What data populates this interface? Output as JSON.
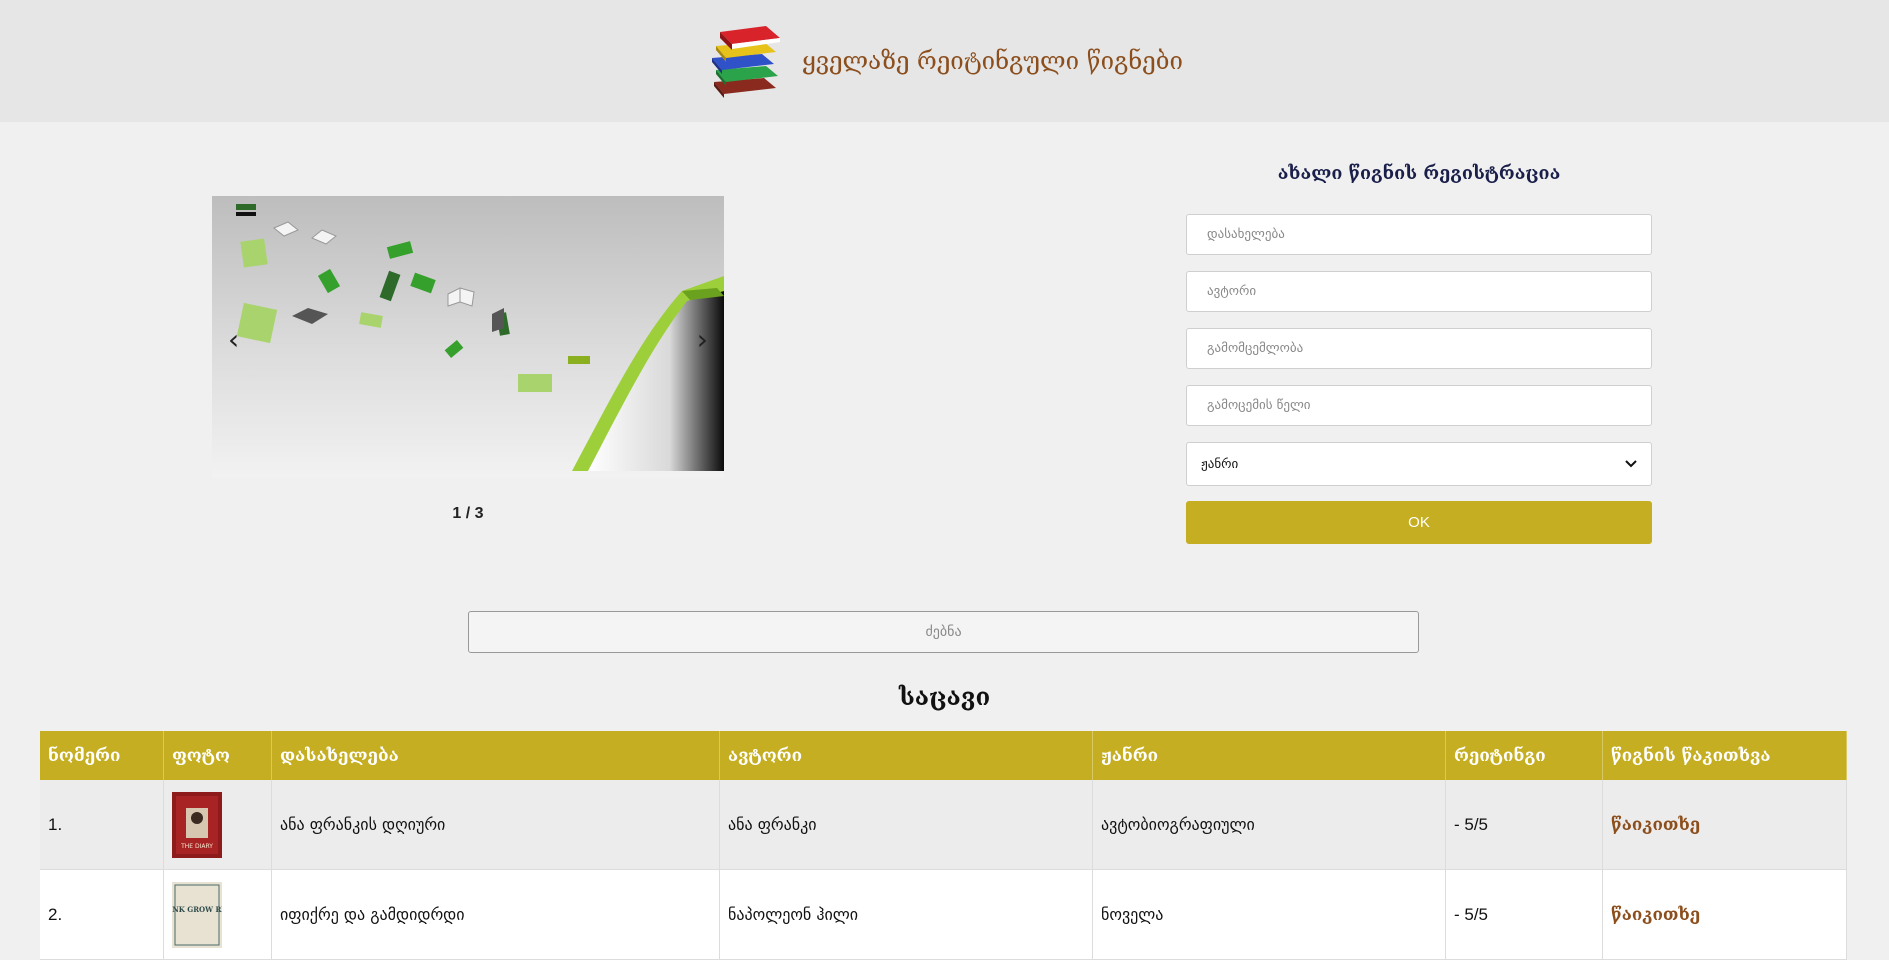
{
  "header": {
    "title": "ყველაზე რეიტინგული წიგნები",
    "logo_icon": "books-stack-icon"
  },
  "carousel": {
    "prev": "‹",
    "next": "›",
    "counter": "1 / 3"
  },
  "form": {
    "title": "ახალი წიგნის რეგისტრაცია",
    "name_placeholder": "დასახელება",
    "author_placeholder": "ავტორი",
    "publisher_placeholder": "გამომცემლობა",
    "year_placeholder": "გამოცემის წელი",
    "genre_selected": "ჟანრი",
    "submit_label": "OK"
  },
  "search": {
    "placeholder": "ძებნა"
  },
  "section_title": "საცავი",
  "table": {
    "headers": [
      "ნომერი",
      "ფოტო",
      "დასახელება",
      "ავტორი",
      "ჟანრი",
      "რეიტინგი",
      "წიგნის წაკითხვა"
    ],
    "rows": [
      {
        "num": "1.",
        "title": "ანა ფრანკის დღიური",
        "author": "ანა ფრანკი",
        "genre": "ავტობიოგრაფიული",
        "rating": "- 5/5",
        "read": "წაიკითხე",
        "cover_text": "THE DIARY"
      },
      {
        "num": "2.",
        "title": "იფიქრე და გამდიდრდი",
        "author": "ნაპოლეონ ჰილი",
        "genre": "ნოველა",
        "rating": "- 5/5",
        "read": "წაიკითხე",
        "cover_text": "THINK GROW RICH"
      }
    ]
  },
  "colors": {
    "accent": "#c5ae22",
    "title_brown": "#8b4e1c",
    "form_title": "#1a1f4a"
  }
}
